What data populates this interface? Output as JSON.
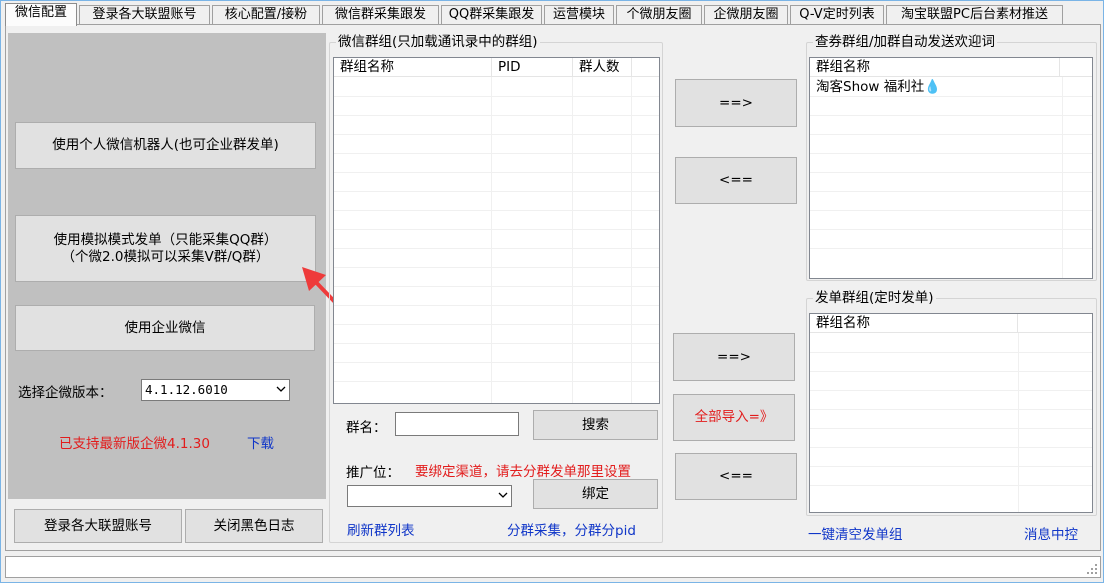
{
  "tabs": [
    {
      "label": "微信配置",
      "active": true
    },
    {
      "label": "登录各大联盟账号"
    },
    {
      "label": "核心配置/接粉"
    },
    {
      "label": "微信群采集跟发"
    },
    {
      "label": "QQ群采集跟发"
    },
    {
      "label": "运营模块"
    },
    {
      "label": "个微朋友圈"
    },
    {
      "label": "企微朋友圈"
    },
    {
      "label": "Q-V定时列表"
    },
    {
      "label": "淘宝联盟PC后台素材推送"
    }
  ],
  "left": {
    "personal_bot_button": "使用个人微信机器人(也可企业群发单)",
    "simulate_button_line1": "使用模拟模式发单（只能采集QQ群）",
    "simulate_button_line2": "（个微2.0模拟可以采集V群/Q群）",
    "enterprise_button": "使用企业微信",
    "version_label": "选择企微版本：",
    "version_value": "4.1.12.6010",
    "supported_text": "已支持最新版企微4.1.30",
    "download_link": "下载",
    "login_alliance_button": "登录各大联盟账号",
    "close_log_button": "关闭黑色日志"
  },
  "wechat_groups": {
    "title": "微信群组(只加载通讯录中的群组)",
    "columns": [
      "群组名称",
      "PID",
      "群人数"
    ],
    "group_name_label": "群名：",
    "search_button": "搜索",
    "promo_label": "推广位：",
    "promo_hint": "要绑定渠道，请去分群发单那里设置",
    "bind_button": "绑定",
    "refresh_link": "刷新群列表",
    "split_link": "分群采集，分群分pid"
  },
  "middle": {
    "add_top": "==>",
    "remove_top": "<==",
    "add_bottom": "==>",
    "import_all": "全部导入=》",
    "remove_bottom": "<=="
  },
  "coupon_groups": {
    "title": "查券群组/加群自动发送欢迎词",
    "columns": [
      "群组名称"
    ],
    "rows": [
      "淘客Show  福利社💧"
    ]
  },
  "send_groups": {
    "title": "发单群组(定时发单)",
    "columns": [
      "群组名称"
    ],
    "clear_link": "一键清空发单组",
    "message_link": "消息中控"
  },
  "colors": {
    "accent_red": "#e21c1c",
    "link_blue": "#1036c8",
    "panel_gray": "#c0c0c0",
    "arrow_red": "#ee3b3b"
  }
}
